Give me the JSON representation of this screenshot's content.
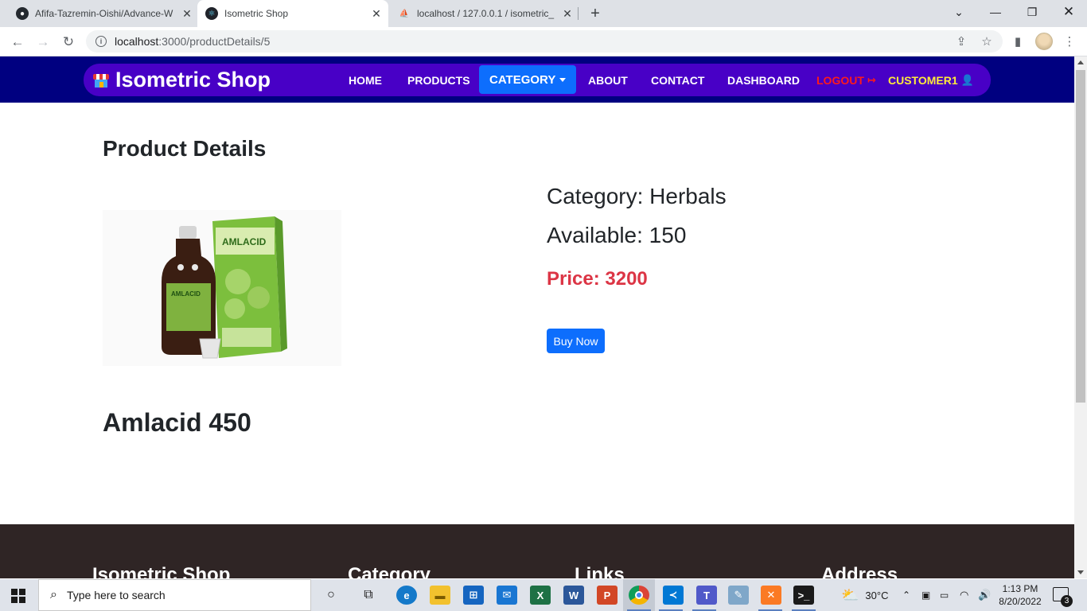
{
  "browser": {
    "tabs": [
      {
        "title": "Afifa-Tazremin-Oishi/Advance-W",
        "icon": "github-icon"
      },
      {
        "title": "Isometric Shop",
        "icon": "react-icon"
      },
      {
        "title": "localhost / 127.0.0.1 / isometric_",
        "icon": "phpmyadmin-icon"
      }
    ],
    "url_host": "localhost",
    "url_path": ":3000/productDetails/5"
  },
  "navbar": {
    "brand": "Isometric Shop",
    "links": {
      "home": "HOME",
      "products": "PRODUCTS",
      "category": "CATEGORY",
      "about": "ABOUT",
      "contact": "CONTACT",
      "dashboard": "DASHBOARD",
      "logout": "LOGOUT",
      "customer": "CUSTOMER1"
    },
    "colors": {
      "bar": "#000080",
      "pill": "#4800c6",
      "category_bg": "#0d6efd",
      "logout": "#ff1a1a",
      "customer": "#ffeb3b"
    }
  },
  "main": {
    "heading": "Product Details",
    "category": "Category: Herbals",
    "available": "Available: 150",
    "price": "Price: 3200",
    "buy_button": "Buy Now",
    "product_name": "Amlacid 450",
    "image_box_text": "AMLACID",
    "bottle_label": "AMLACID"
  },
  "footer": {
    "headings": [
      "Isometric Shop",
      "Category",
      "Links",
      "Address"
    ]
  },
  "taskbar": {
    "search_placeholder": "Type here to search",
    "weather": "30°C",
    "time": "1:13 PM",
    "date": "8/20/2022",
    "notifications": "3"
  }
}
